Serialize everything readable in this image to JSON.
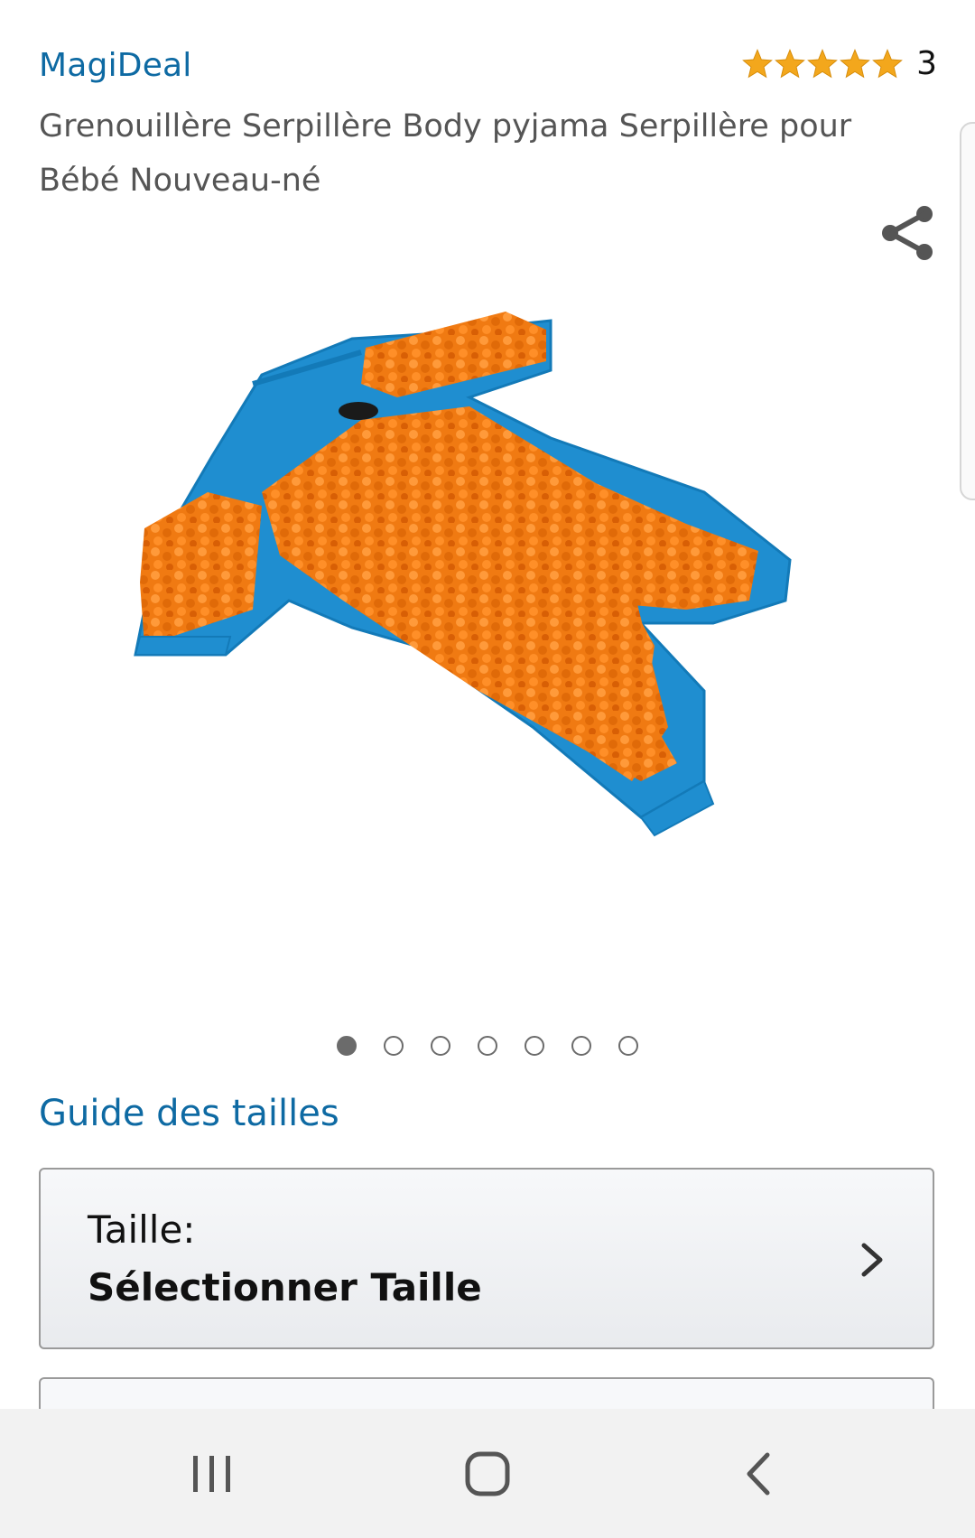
{
  "product": {
    "brand": "MagiDeal",
    "rating_count": "3",
    "rating_stars": 5,
    "title": "Grenouillère Serpillère Body pyjama Serpillère pour Bébé Nouveau-né"
  },
  "gallery": {
    "image_count": 7,
    "active_index": 0
  },
  "size_guide_link": "Guide des tailles",
  "size_selector": {
    "label": "Taille:",
    "value": "Sélectionner Taille"
  },
  "colors": {
    "link_blue": "#0e6aa3",
    "star_orange": "#f3a71c",
    "romper_blue": "#1f8ed0",
    "mop_orange": "#f07a12"
  },
  "icons": {
    "share": "share-icon",
    "chevron": "chevron-right-icon",
    "nav_recent": "recent-apps-icon",
    "nav_home": "home-icon",
    "nav_back": "back-icon"
  }
}
